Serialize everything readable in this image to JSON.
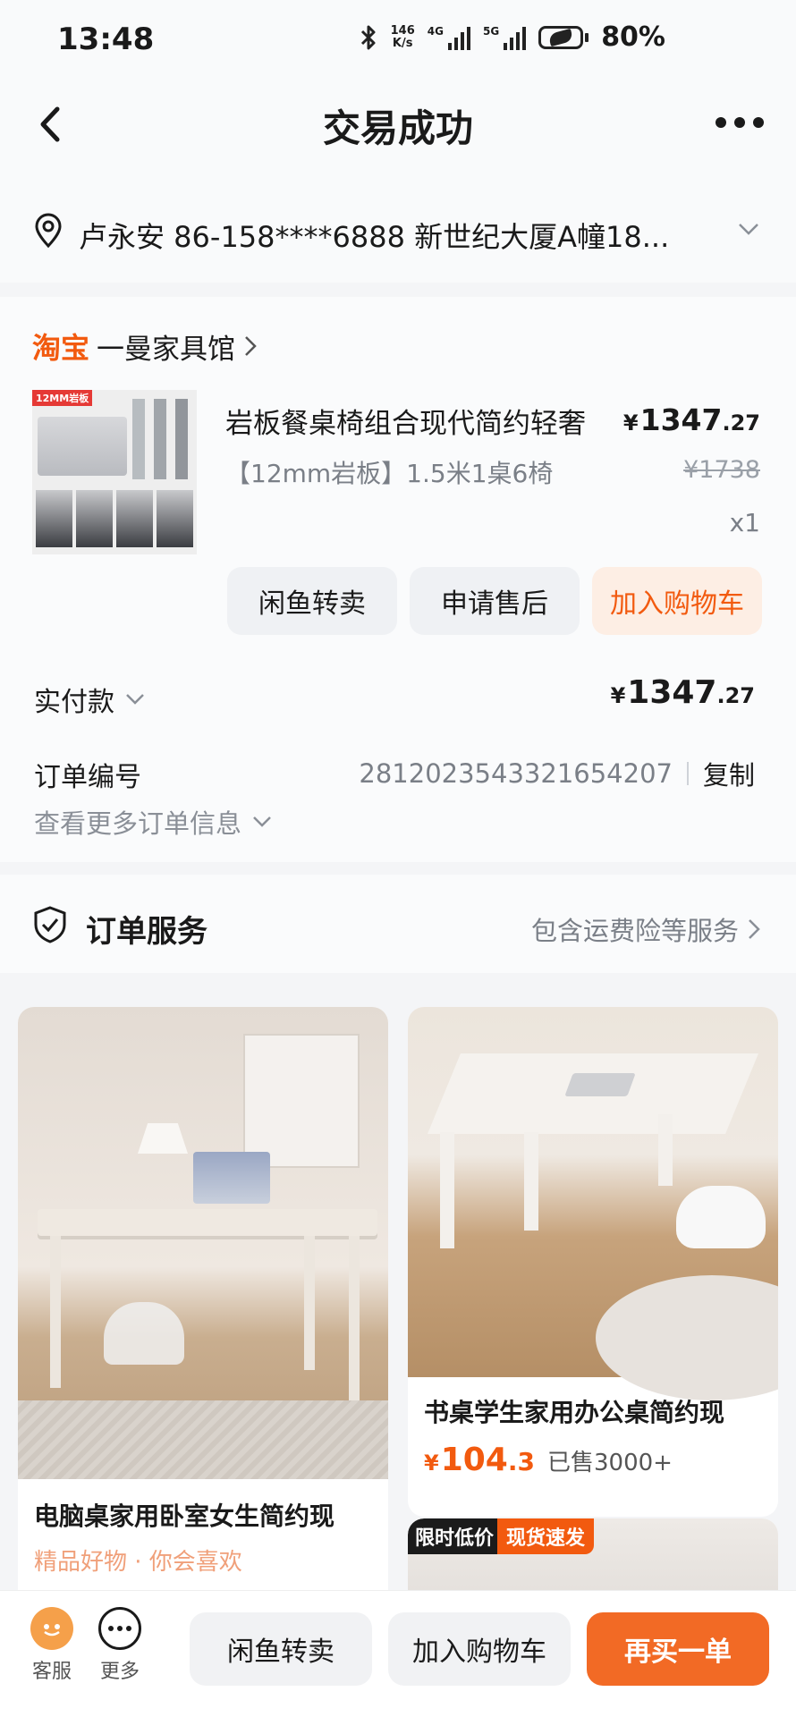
{
  "status_bar": {
    "time": "13:48",
    "net_speed": "146",
    "net_unit": "K/s",
    "sig1": "4G",
    "sig2": "5G",
    "battery": "80%"
  },
  "nav": {
    "title": "交易成功"
  },
  "address": {
    "text": "卢永安 86-158****6888 新世纪大厦A幢18..."
  },
  "order": {
    "platform": "淘宝",
    "shop_name": "一曼家具馆",
    "product": {
      "thumb_label": "12MM岩板",
      "name": "岩板餐桌椅组合现代简约轻奢",
      "spec": "【12mm岩板】1.5米1桌6椅",
      "price_int": "1347",
      "price_dec": ".27",
      "currency": "¥",
      "original_price": "¥1738",
      "quantity": "x1"
    },
    "actions": [
      "闲鱼转卖",
      "申请售后",
      "加入购物车"
    ],
    "paid_label": "实付款",
    "paid_int": "1347",
    "paid_dec": ".27",
    "order_no_label": "订单编号",
    "order_no": "2812023543321654207",
    "copy_label": "复制",
    "more_info": "查看更多订单信息"
  },
  "service": {
    "title": "订单服务",
    "link": "包含运费险等服务"
  },
  "feed": [
    {
      "title": "电脑桌家用卧室女生简约现",
      "subtitle": "精品好物 · 你会喜欢"
    },
    {
      "title": "书桌学生家用办公桌简约现",
      "currency": "¥",
      "price_int": "104",
      "price_dec": ".3",
      "sold": "已售3000+"
    },
    {
      "badge1": "限时低价",
      "badge2": "现货速发"
    }
  ],
  "bottom_bar": {
    "icon1_label": "客服",
    "icon2_label": "更多",
    "buttons": [
      "闲鱼转卖",
      "加入购物车",
      "再买一单"
    ]
  }
}
